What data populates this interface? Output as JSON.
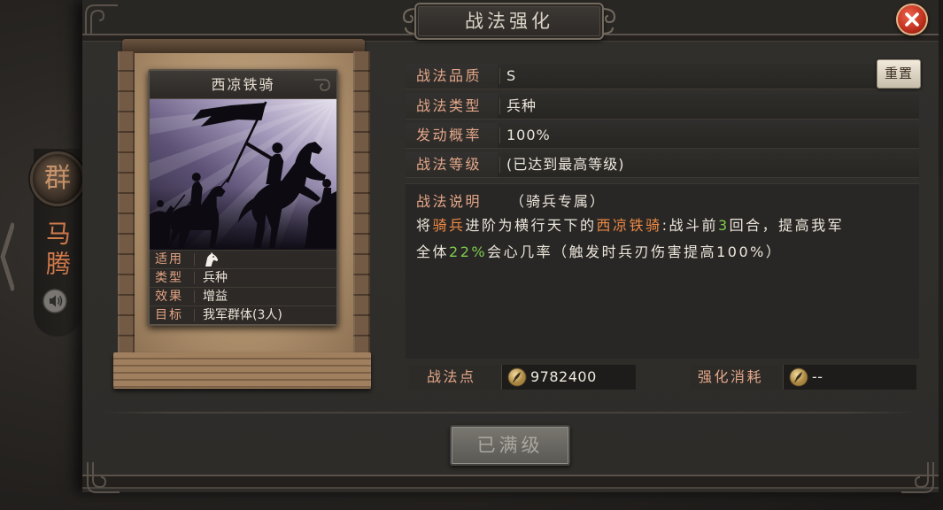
{
  "window": {
    "title": "战法强化"
  },
  "icons": {
    "close": "close-icon",
    "speaker": "speaker-icon",
    "horse": "horse-head-icon",
    "coin": "coin-icon"
  },
  "colors": {
    "label": "#e3a689",
    "value": "#ece6dc",
    "highlight_unit": "#ee8a45",
    "highlight_number": "#7fcb4f",
    "close_button": "#c0301e",
    "disabled_button": "#6a6863"
  },
  "hero": {
    "faction": "群",
    "name": "马腾"
  },
  "card": {
    "name": "西凉铁骑",
    "rows": [
      {
        "label": "适用",
        "icon": "horse-head-icon"
      },
      {
        "label": "类型",
        "value": "兵种"
      },
      {
        "label": "效果",
        "value": "增益"
      },
      {
        "label": "目标",
        "value": "我军群体(3人)"
      }
    ]
  },
  "details": {
    "rows": [
      {
        "label": "战法品质",
        "value": "S"
      },
      {
        "label": "战法类型",
        "value": "兵种"
      },
      {
        "label": "发动概率",
        "value": "100%"
      },
      {
        "label": "战法等级",
        "value": "(已达到最高等级)"
      }
    ],
    "reset_label": "重置"
  },
  "description": {
    "label": "战法说明",
    "tag": "（骑兵专属）",
    "segments": [
      {
        "text": "将",
        "color": "#ece6dc"
      },
      {
        "text": "骑兵",
        "color": "#ee8a45"
      },
      {
        "text": "进阶为横行天下的",
        "color": "#ece6dc"
      },
      {
        "text": "西凉铁骑",
        "color": "#ee8a45"
      },
      {
        "text": ":战斗前",
        "color": "#ece6dc"
      },
      {
        "text": "3",
        "color": "#7fcb4f"
      },
      {
        "text": "回合，提高我军",
        "color": "#ece6dc"
      },
      {
        "text": "全体",
        "color": "#ece6dc"
      },
      {
        "text": "22%",
        "color": "#7fcb4f"
      },
      {
        "text": "会心几率（触发时兵刃伤害提高100%）",
        "color": "#ece6dc"
      }
    ]
  },
  "resources": {
    "points": {
      "label": "战法点",
      "value": "9782400"
    },
    "cost": {
      "label": "强化消耗",
      "value": "--"
    }
  },
  "footer": {
    "max_level_label": "已满级"
  }
}
